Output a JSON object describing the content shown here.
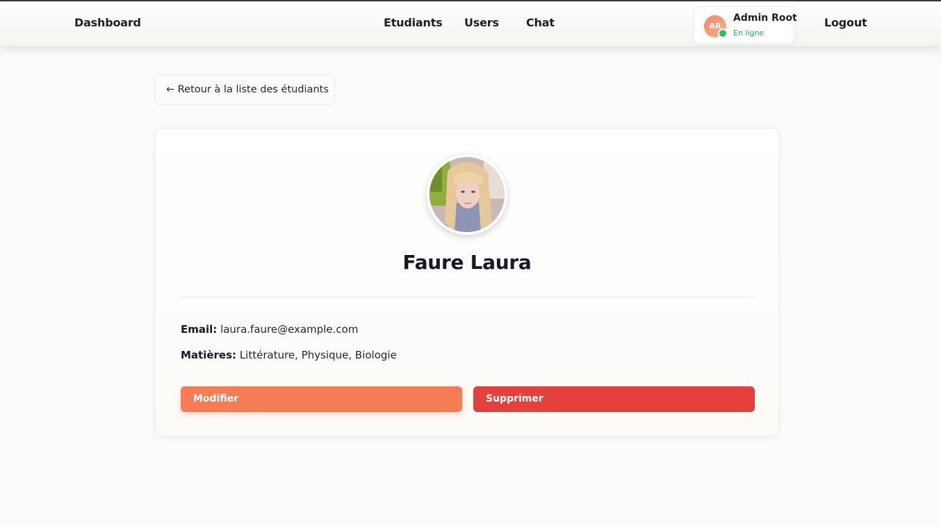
{
  "navbar": {
    "brand": "Dashboard",
    "links": [
      "Etudiants",
      "Users",
      "Chat"
    ],
    "logout": "Logout",
    "user": {
      "initials": "AR",
      "name": "Admin Root",
      "status": "En ligne"
    }
  },
  "back_button": "← Retour à la liste des étudiants",
  "student": {
    "name": "Faure Laura",
    "email_label": "Email:",
    "email": "laura.faure@example.com",
    "subjects_label": "Matières:",
    "subjects": "Littérature, Physique, Biologie"
  },
  "actions": {
    "edit": "Modifier",
    "delete": "Supprimer"
  },
  "colors": {
    "accent": "#f57c53",
    "danger": "#e4403c",
    "online": "#22c55e"
  }
}
